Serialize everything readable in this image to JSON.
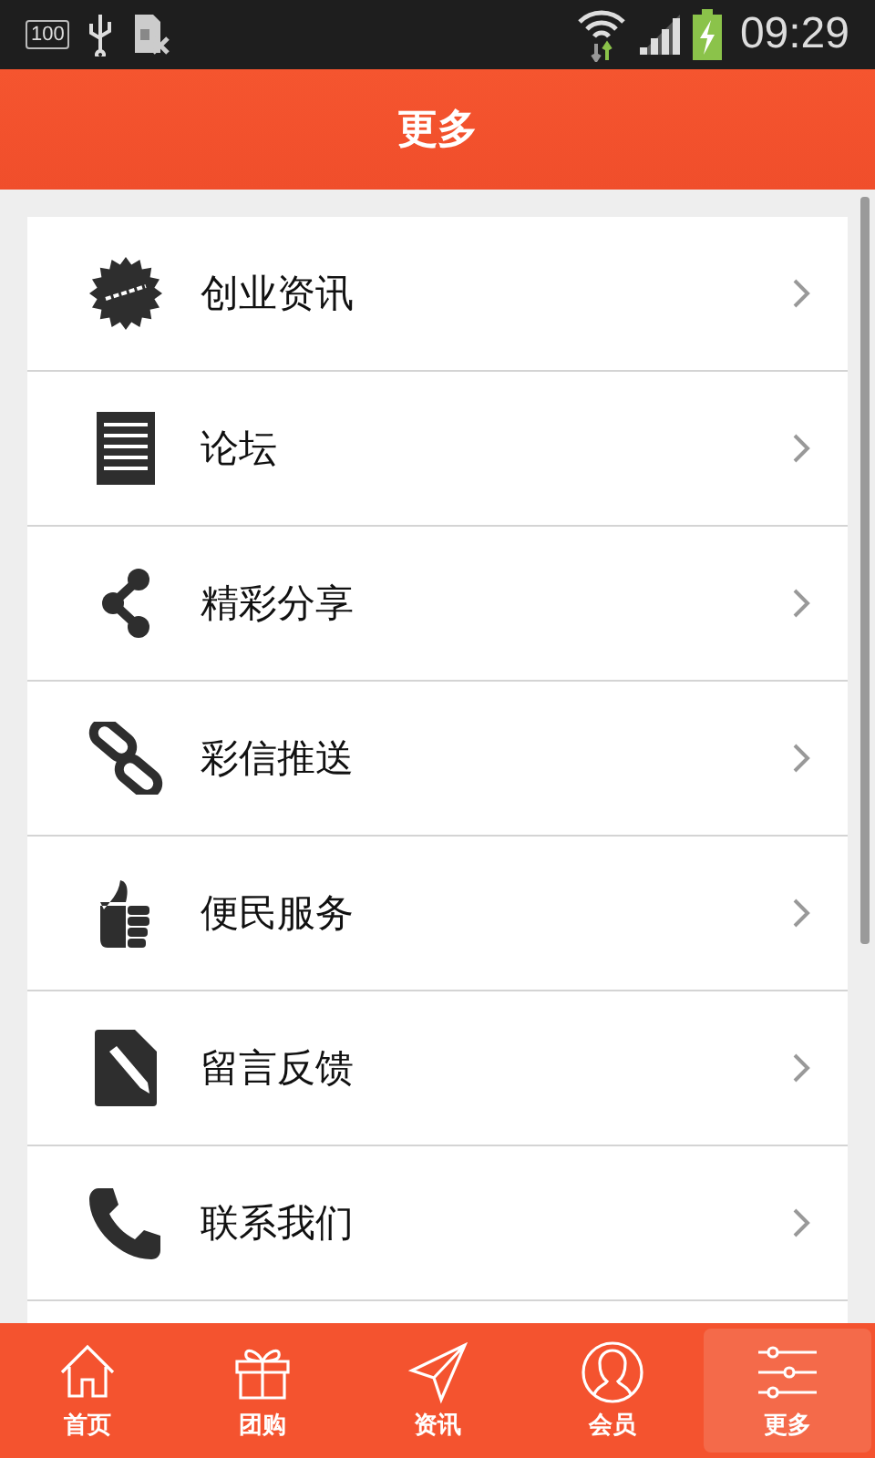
{
  "status_bar": {
    "battery_level_text": "100",
    "time": "09:29"
  },
  "header": {
    "title": "更多"
  },
  "menu_items": [
    {
      "label": "创业资讯"
    },
    {
      "label": "论坛"
    },
    {
      "label": "精彩分享"
    },
    {
      "label": "彩信推送"
    },
    {
      "label": "便民服务"
    },
    {
      "label": "留言反馈"
    },
    {
      "label": "联系我们"
    }
  ],
  "tab_bar": [
    {
      "label": "首页",
      "selected": false
    },
    {
      "label": "团购",
      "selected": false
    },
    {
      "label": "资讯",
      "selected": false
    },
    {
      "label": "会员",
      "selected": false
    },
    {
      "label": "更多",
      "selected": true
    }
  ]
}
